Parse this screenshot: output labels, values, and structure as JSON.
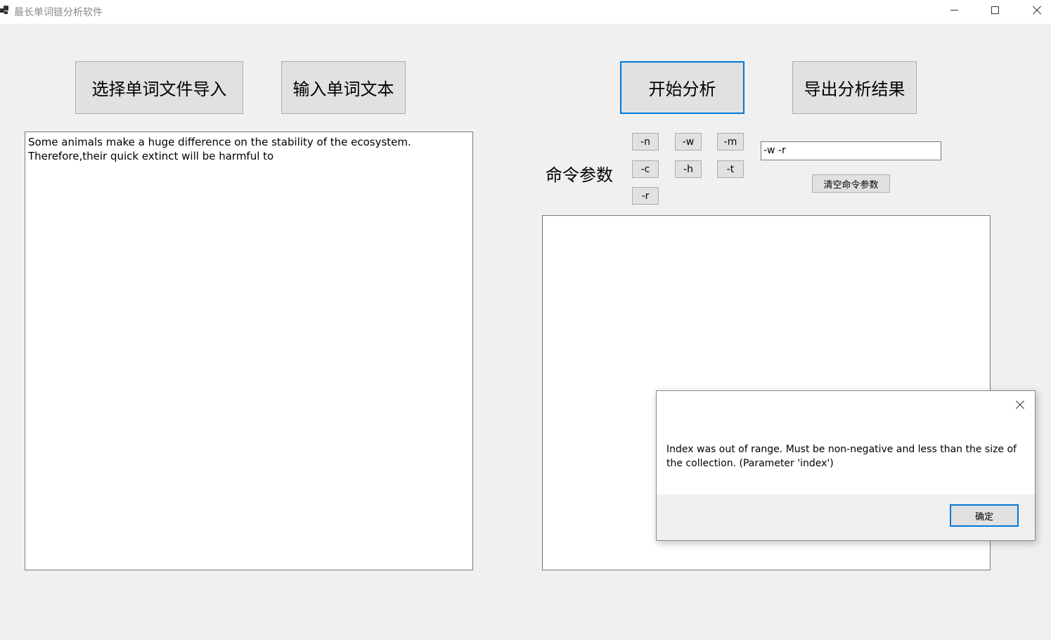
{
  "window": {
    "title": "最长单词链分析软件",
    "icons": {
      "app": "app-icon",
      "minimize": "minimize-icon",
      "maximize": "maximize-icon",
      "close": "close-icon"
    }
  },
  "toolbar": {
    "import_file_label": "选择单词文件导入",
    "input_text_label": "输入单词文本",
    "start_analysis_label": "开始分析",
    "export_results_label": "导出分析结果"
  },
  "input_area": {
    "text": "Some animals make a huge difference on the stability of the ecosystem.\nTherefore,their quick extinct will be harmful to"
  },
  "command": {
    "label": "命令参数",
    "flags": [
      "-n",
      "-w",
      "-m",
      "-c",
      "-h",
      "-t",
      "-r"
    ],
    "params_value": "-w -r",
    "clear_label": "清空命令参数"
  },
  "output_area": {
    "text": ""
  },
  "dialog": {
    "message": "Index was out of range. Must be non-negative and less than the size of the collection. (Parameter 'index')",
    "ok_label": "确定"
  },
  "colors": {
    "accent": "#0078d7",
    "window_bg": "#f0f0f0",
    "button_bg": "#e1e1e1"
  }
}
